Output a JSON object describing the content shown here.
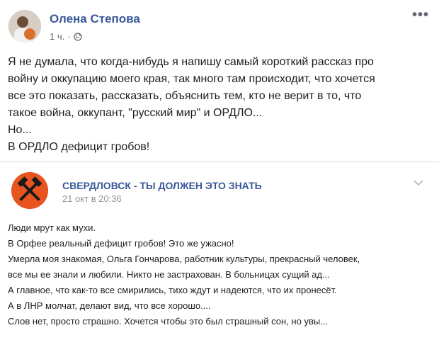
{
  "post": {
    "author": "Олена Степова",
    "time": "1 ч.",
    "dot": "·",
    "more_icon": "more-dots-icon",
    "lines": [
      "Я не думала, что когда-нибудь я напишу самый короткий рассказ про",
      "войну и оккупацию моего края, так много там происходит, что хочется",
      "все это показать, рассказать, объяснить тем, кто не верит в то, что",
      "такое война, оккупант, \"русский мир\" и ОРДЛО...",
      "Но...",
      "В ОРДЛО дефицит гробов!"
    ]
  },
  "shared": {
    "page_name": "СВЕРДЛОВСК - ТЫ ДОЛЖЕН ЭТО ЗНАТЬ",
    "time": "21 окт в 20:36",
    "lines": [
      "Люди мрут как мухи.",
      "В Орфее реальный дефицит гробов! Это же ужасно!",
      "Умерла моя знакомая, Ольга Гончарова, работник культуры, прекрасный человек,",
      "все мы ее знали и любили. Никто не застрахован. В больницах сущий ад...",
      "А главное, что как-то все смирились, тихо ждут и надеются, что их пронесёт.",
      "А в ЛНР молчат, делают вид, что все хорошо....",
      "Слов нет, просто страшно. Хочется чтобы это был страшный сон, но увы..."
    ]
  },
  "colors": {
    "link": "#385898",
    "meta": "#606770",
    "logo_bg": "#e8541f"
  }
}
